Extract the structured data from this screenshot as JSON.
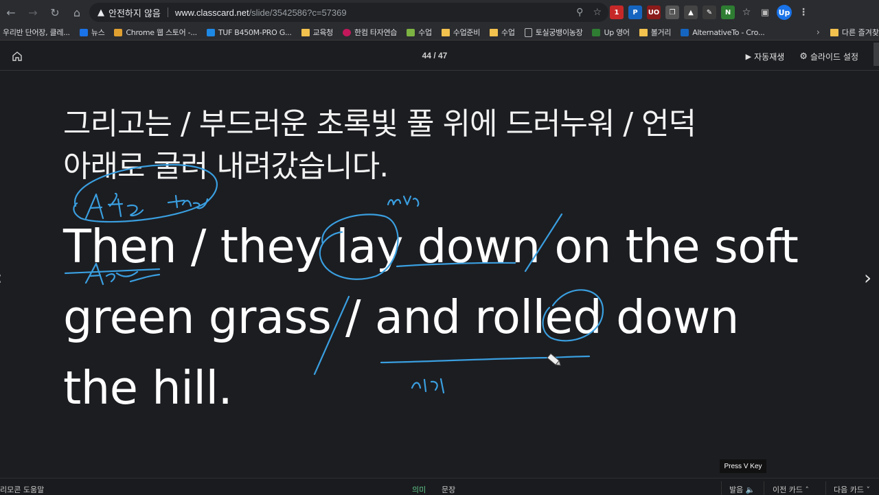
{
  "browser": {
    "security_label": "안전하지 않음",
    "url_host": "www.classcard.net",
    "url_path": "/slide/3542586?c=57369",
    "profile_initial": "Up"
  },
  "bookmarks": [
    {
      "label": "우리반 단어장, 클레..."
    },
    {
      "label": "뉴스"
    },
    {
      "label": "Chrome 웹 스토어 -..."
    },
    {
      "label": "TUF B450M-PRO G..."
    },
    {
      "label": "교육청"
    },
    {
      "label": "한컴 타자연습"
    },
    {
      "label": "수업"
    },
    {
      "label": "수업준비"
    },
    {
      "label": "수업"
    },
    {
      "label": "토실궁뱅이농장"
    },
    {
      "label": "Up 영어"
    },
    {
      "label": "볼거리"
    },
    {
      "label": "AlternativeTo - Cro..."
    }
  ],
  "bookmarks_other": "다른 즐겨찾",
  "header": {
    "counter": "44 / 47",
    "autoplay_label": "자동재생",
    "settings_label": "슬라이드 설정"
  },
  "slide": {
    "korean_line1": "그리고는 / 부드러운 초록빛 풀 위에 드러누워 / 언덕",
    "korean_line2": "아래로 굴러 내려갔습니다.",
    "english_line1": "Then / they lay down on the soft",
    "english_line2": "green grass / and rolled down",
    "english_line3": "the hill."
  },
  "tooltip": "Press V Key",
  "bottom": {
    "help": "리모콘 도움말",
    "meaning": "의미",
    "sentence": "문장",
    "pronounce": "발음",
    "prev_card": "이전 카드",
    "next_card": "다음 카드"
  },
  "colors": {
    "background": "#1c1d21",
    "annotation": "#3a9fe0",
    "active_tab": "#5ec48a"
  }
}
